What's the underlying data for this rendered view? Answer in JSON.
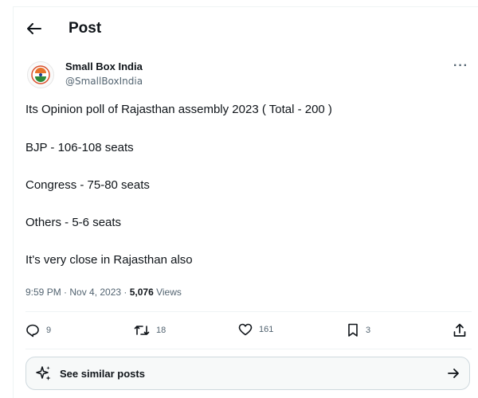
{
  "header": {
    "title": "Post"
  },
  "post": {
    "author_name": "Small Box India",
    "author_handle": "@SmallBoxIndia",
    "lines": [
      "Its Opinion poll of Rajasthan assembly 2023 ( Total - 200 )",
      "BJP - 106-108 seats",
      "Congress - 75-80 seats",
      "Others - 5-6 seats",
      "It's very close in Rajasthan also"
    ],
    "timestamp": "9:59 PM · Nov 4, 2023 · ",
    "views_count": "5,076",
    "views_label": " Views"
  },
  "actions": {
    "replies": "9",
    "reposts": "18",
    "likes": "161",
    "bookmarks": "3"
  },
  "similar": {
    "label": "See similar posts"
  },
  "colors": {
    "text": "#0f1419",
    "secondary": "#536471",
    "border": "#eff3f4"
  }
}
